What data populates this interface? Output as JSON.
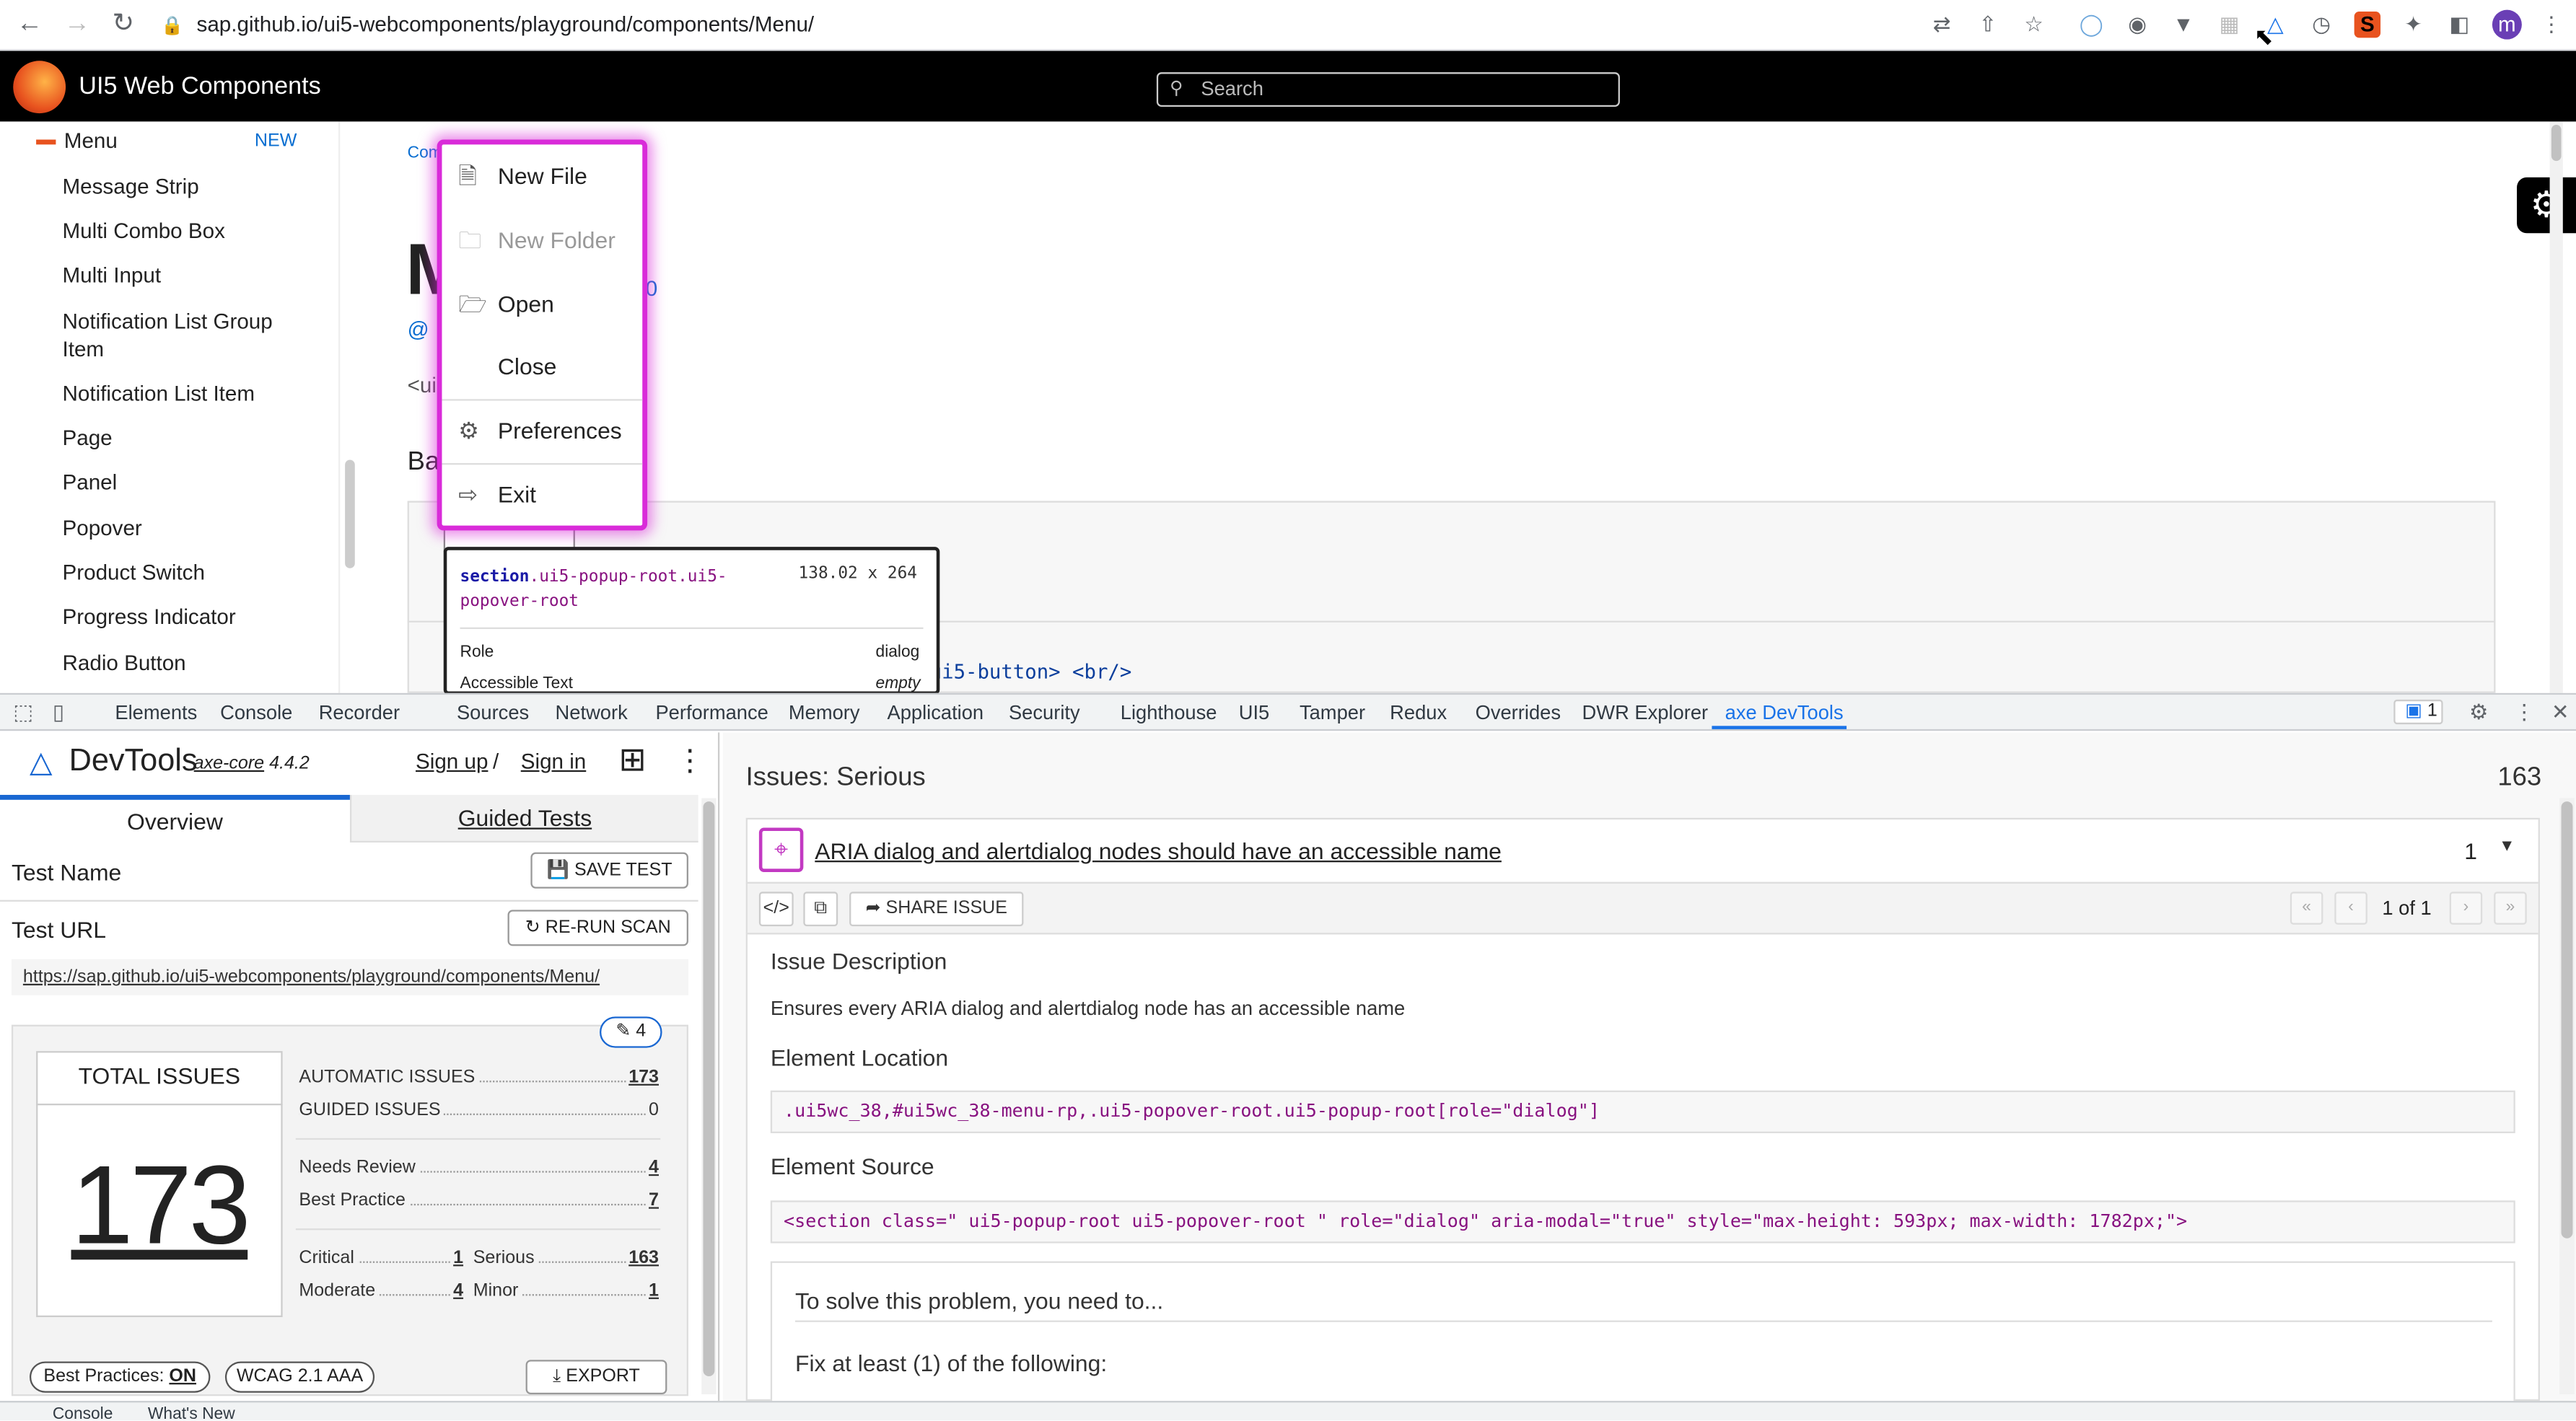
{
  "browser": {
    "url": "sap.github.io/ui5-webcomponents/playground/components/Menu/"
  },
  "header": {
    "title": "UI5 Web Components",
    "search_placeholder": "Search"
  },
  "sidebar": {
    "active_item": "Menu",
    "new_badge": "NEW",
    "items": [
      {
        "label": "Message Strip"
      },
      {
        "label": "Multi Combo Box"
      },
      {
        "label": "Multi Input"
      },
      {
        "label": "Notification List Group Item"
      },
      {
        "label": "Notification List Item"
      },
      {
        "label": "Page"
      },
      {
        "label": "Panel"
      },
      {
        "label": "Popover"
      },
      {
        "label": "Product Switch"
      },
      {
        "label": "Progress Indicator"
      },
      {
        "label": "Radio Button"
      }
    ]
  },
  "main": {
    "crumb": "Com",
    "heading_fragment": "M",
    "version_fragment": "0",
    "tag_fragment": "<ui",
    "section_fragment": "Bas",
    "code_fragment": "ui5-button> <br/>"
  },
  "menu": {
    "items": [
      {
        "label": "New File",
        "icon": "add-document-icon",
        "disabled": false
      },
      {
        "label": "New Folder",
        "icon": "add-folder-icon",
        "disabled": true
      },
      {
        "label": "Open",
        "icon": "open-folder-icon",
        "disabled": false
      },
      {
        "label": "Close",
        "icon": "",
        "disabled": false
      },
      {
        "label": "Preferences",
        "icon": "gear-icon",
        "disabled": false
      },
      {
        "label": "Exit",
        "icon": "exit-icon",
        "disabled": false
      }
    ]
  },
  "inspect_tooltip": {
    "tag": "section",
    "classes": ".ui5-popup-root.ui5-popover-root",
    "dimensions": "138.02 x 264",
    "role_label": "Role",
    "role_value": "dialog",
    "accessible_label": "Accessible Text",
    "accessible_value": "empty"
  },
  "devtools": {
    "tabs": [
      "Elements",
      "Console",
      "Recorder",
      "Sources",
      "Network",
      "Performance",
      "Memory",
      "Application",
      "Security",
      "Lighthouse",
      "UI5",
      "Tamper",
      "Redux",
      "Overrides",
      "DWR Explorer",
      "axe DevTools"
    ],
    "active_tab": "axe DevTools",
    "issue_badge": "1",
    "drawer_tabs": [
      "Console",
      "What's New"
    ]
  },
  "axe": {
    "brand": "DevTools",
    "core_label": "axe-core",
    "core_version": "4.4.2",
    "sign_up": "Sign up",
    "slash": "/",
    "sign_in": "Sign in",
    "tab_overview": "Overview",
    "tab_guided": "Guided Tests",
    "test_name_label": "Test Name",
    "save_test": "SAVE TEST",
    "test_url_label": "Test URL",
    "rerun_scan": "RE-RUN SCAN",
    "test_url": "https://sap.github.io/ui5-webcomponents/playground/components/Menu/",
    "edit_count": "4",
    "total_label": "TOTAL ISSUES",
    "total_value": "173",
    "automatic_label": "AUTOMATIC ISSUES",
    "automatic_value": "173",
    "guided_label": "GUIDED ISSUES",
    "guided_value": "0",
    "needs_review_label": "Needs Review",
    "needs_review_value": "4",
    "best_practice_label": "Best Practice",
    "best_practice_value": "7",
    "critical_label": "Critical",
    "critical_value": "1",
    "serious_label": "Serious",
    "serious_value": "163",
    "moderate_label": "Moderate",
    "moderate_value": "4",
    "minor_label": "Minor",
    "minor_value": "1",
    "best_practices_pill": "Best Practices:",
    "best_practices_state": "ON",
    "wcag_pill": "WCAG 2.1 AAA",
    "export": "EXPORT"
  },
  "issues": {
    "title": "Issues: Serious",
    "count": "163",
    "issue_title": "ARIA dialog and alertdialog nodes should have an accessible name",
    "issue_instances": "1",
    "share_issue": "SHARE ISSUE",
    "pagination": "1 of 1",
    "description_heading": "Issue Description",
    "description": "Ensures every ARIA dialog and alertdialog node has an accessible name",
    "location_heading": "Element Location",
    "location": ".ui5wc_38,#ui5wc_38-menu-rp,.ui5-popover-root.ui5-popup-root[role=\"dialog\"]",
    "source_heading": "Element Source",
    "source": "<section class=\" ui5-popup-root ui5-popover-root \" role=\"dialog\" aria-modal=\"true\" style=\"max-height: 593px; max-width: 1782px;\">",
    "solve_heading": "To solve this problem, you need to...",
    "fix_heading": "Fix at least (1) of the following:"
  }
}
